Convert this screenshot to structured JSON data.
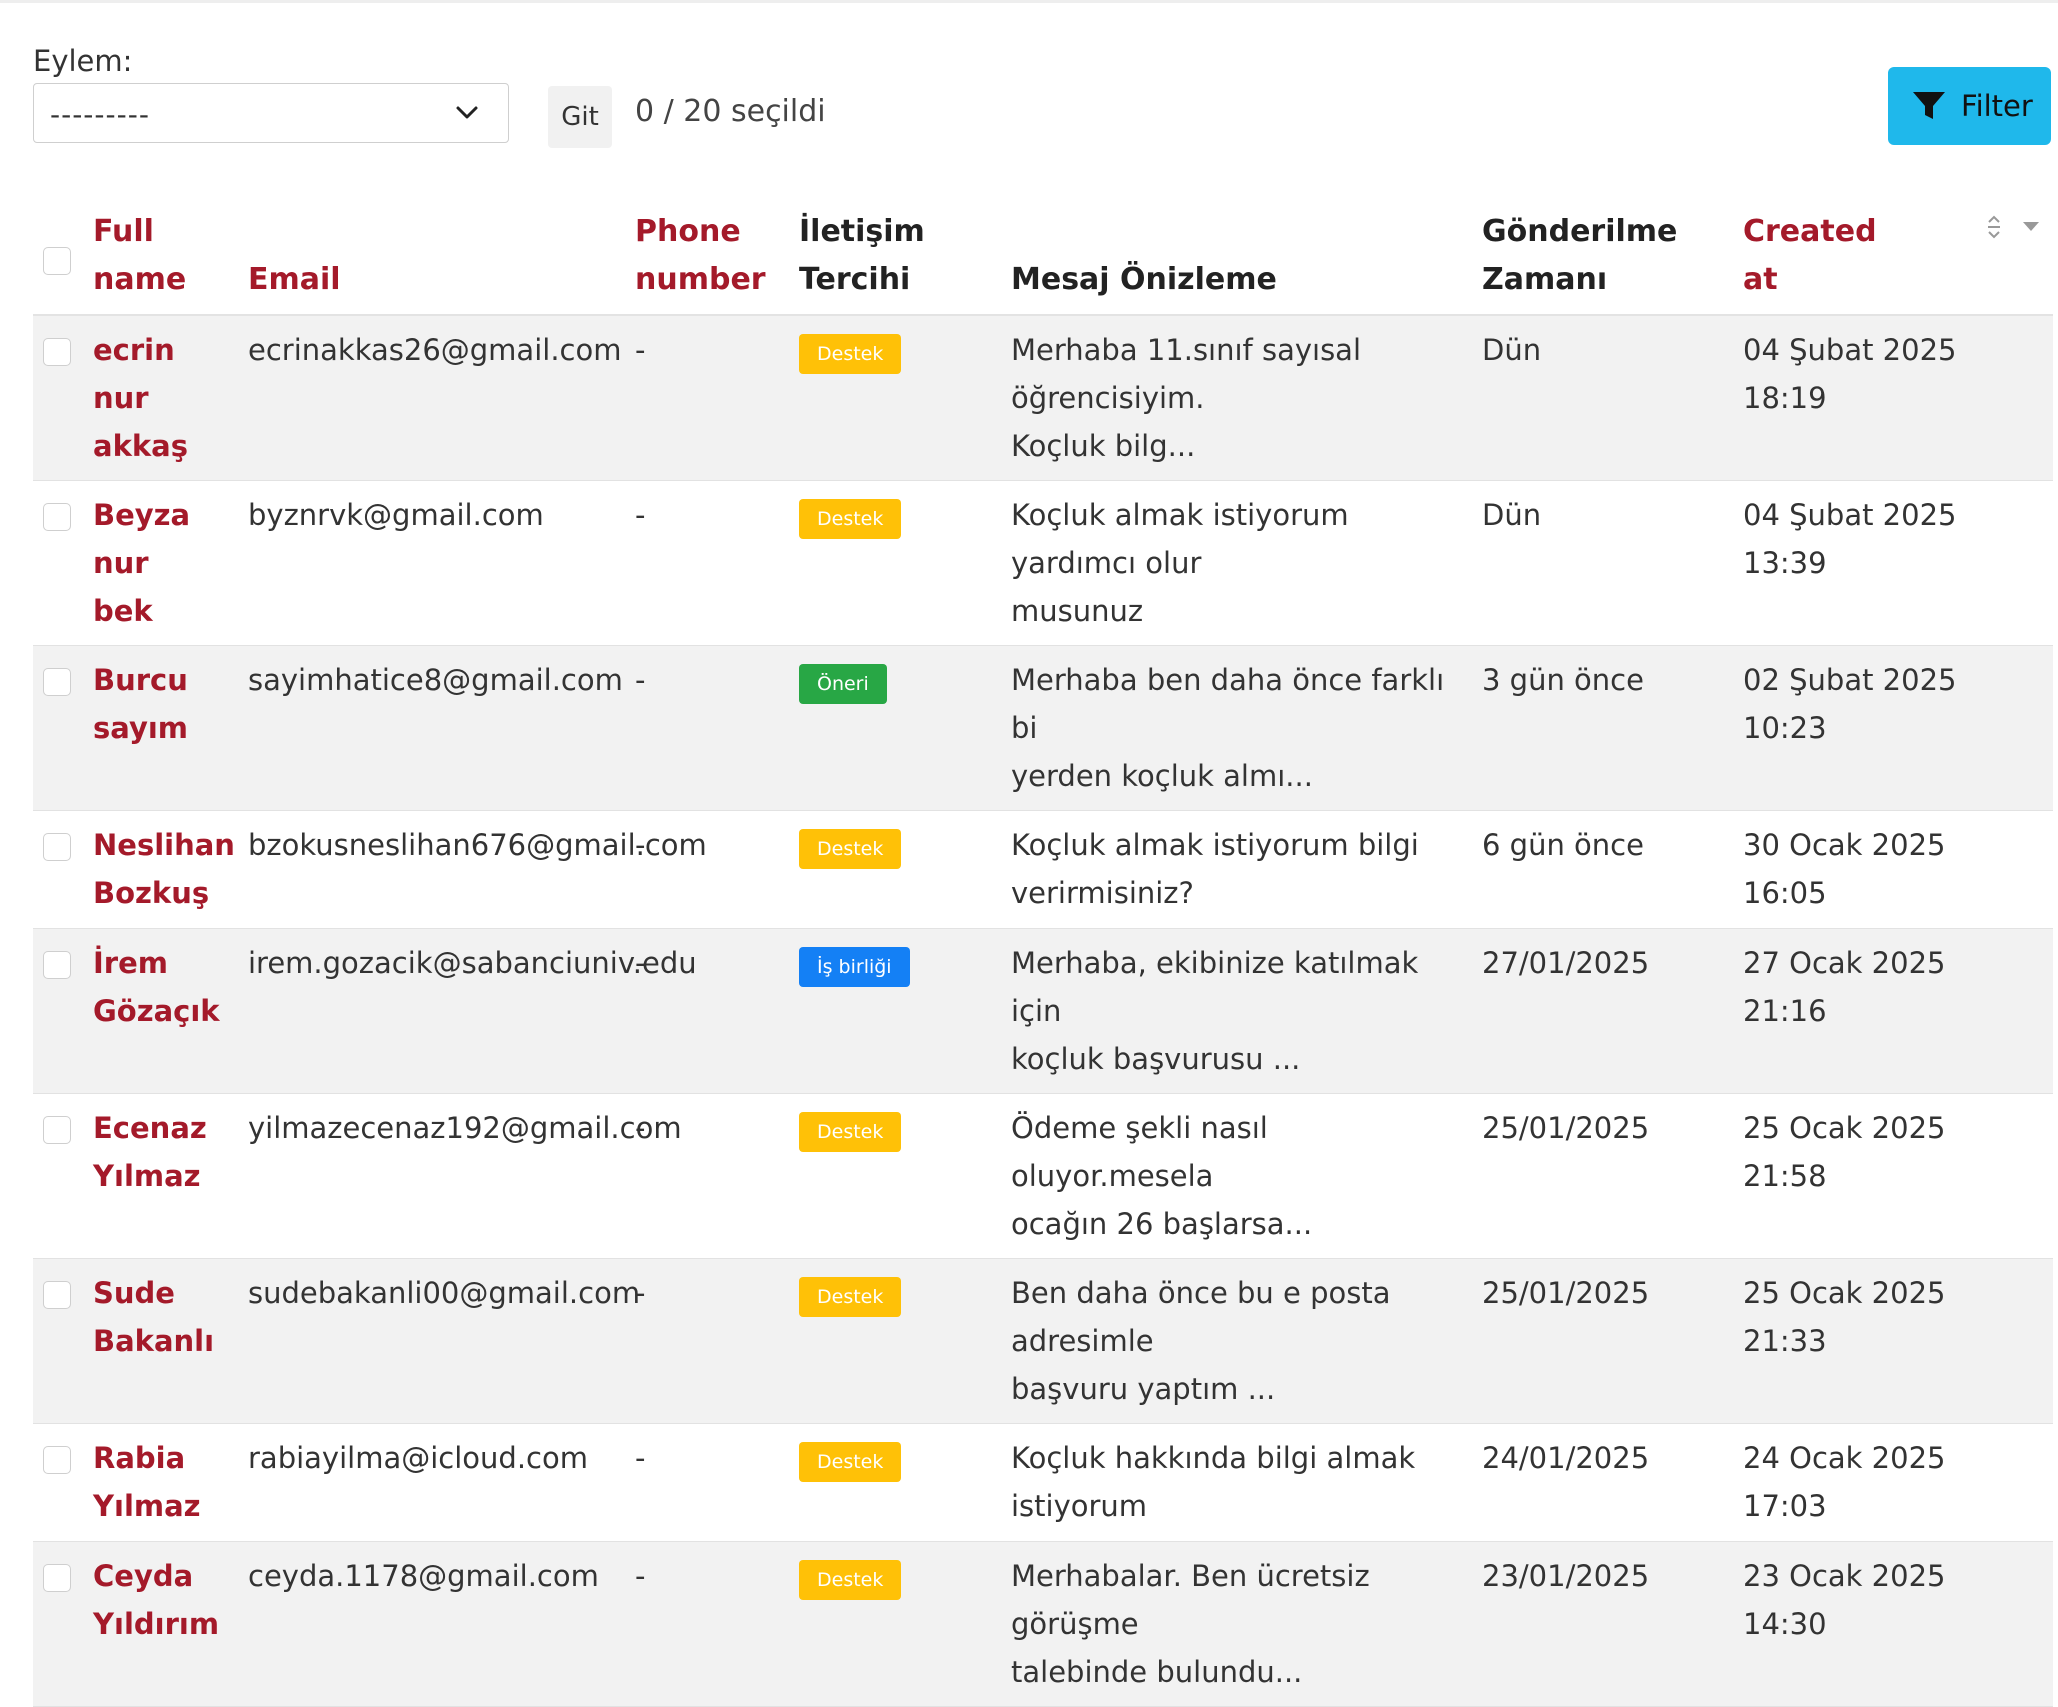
{
  "actions": {
    "label": "Eylem:",
    "selected_value": "---------",
    "go_label": "Git",
    "selection_counter": "0 / 20 seçildi"
  },
  "filter_button": {
    "label": "Filter",
    "color": "#1fb8eb"
  },
  "colors": {
    "link": "#a41a2a",
    "badge_destek": "#ffc107",
    "badge_oneri": "#28a745",
    "badge_isbirligi": "#1480f5"
  },
  "table": {
    "columns": {
      "full_name_l1": "Full",
      "full_name_l2": "name",
      "email": "Email",
      "phone_l1": "Phone",
      "phone_l2": "number",
      "contact_l1": "İletişim",
      "contact_l2": "Tercihi",
      "preview": "Mesaj Önizleme",
      "sent_l1": "Gönderilme",
      "sent_l2": "Zamanı",
      "created_l1": "Created",
      "created_l2": "at"
    },
    "rows": [
      {
        "name_l1": "ecrin nur",
        "name_l2": "akkaş",
        "email": "ecrinakkas26@gmail.com",
        "phone": "-",
        "preference": "Destek",
        "preference_kind": "destek",
        "preview_l1": "Merhaba 11.sınıf sayısal öğrencisiyim.",
        "preview_l2": "Koçluk bilg...",
        "sent": "Dün",
        "created_l1": "04 Şubat 2025",
        "created_l2": "18:19"
      },
      {
        "name_l1": "Beyza nur",
        "name_l2": "bek",
        "email": "byznrvk@gmail.com",
        "phone": "-",
        "preference": "Destek",
        "preference_kind": "destek",
        "preview_l1": "Koçluk almak istiyorum yardımcı olur",
        "preview_l2": "musunuz",
        "sent": "Dün",
        "created_l1": "04 Şubat 2025",
        "created_l2": "13:39"
      },
      {
        "name_l1": "Burcu sayım",
        "name_l2": "",
        "email": "sayimhatice8@gmail.com",
        "phone": "-",
        "preference": "Öneri",
        "preference_kind": "oneri",
        "preview_l1": "Merhaba ben daha önce farklı bi",
        "preview_l2": "yerden koçluk almı...",
        "sent": "3 gün önce",
        "created_l1": "02 Şubat 2025",
        "created_l2": "10:23"
      },
      {
        "name_l1": "Neslihan",
        "name_l2": "Bozkuş",
        "email": "bzokusneslihan676@gmail.com",
        "phone": "-",
        "preference": "Destek",
        "preference_kind": "destek",
        "preview_l1": "Koçluk almak istiyorum bilgi",
        "preview_l2": "verirmisiniz?",
        "sent": "6 gün önce",
        "created_l1": "30 Ocak 2025",
        "created_l2": "16:05"
      },
      {
        "name_l1": "İrem Gözaçık",
        "name_l2": "",
        "email": "irem.gozacik@sabanciuniv.edu",
        "phone": "-",
        "preference": "İş birliği",
        "preference_kind": "isbirligi",
        "preview_l1": "Merhaba, ekibinize katılmak için",
        "preview_l2": "koçluk başvurusu ...",
        "sent": "27/01/2025",
        "created_l1": "27 Ocak 2025",
        "created_l2": "21:16"
      },
      {
        "name_l1": "Ecenaz",
        "name_l2": "Yılmaz",
        "email": "yilmazecenaz192@gmail.com",
        "phone": "-",
        "preference": "Destek",
        "preference_kind": "destek",
        "preview_l1": "Ödeme şekli nasıl oluyor.mesela",
        "preview_l2": "ocağın 26 başlarsa...",
        "sent": "25/01/2025",
        "created_l1": "25 Ocak 2025",
        "created_l2": "21:58"
      },
      {
        "name_l1": "Sude Bakanlı",
        "name_l2": "",
        "email": "sudebakanli00@gmail.com",
        "phone": "-",
        "preference": "Destek",
        "preference_kind": "destek",
        "preview_l1": "Ben daha önce bu e posta adresimle",
        "preview_l2": "başvuru yaptım ...",
        "sent": "25/01/2025",
        "created_l1": "25 Ocak 2025",
        "created_l2": "21:33"
      },
      {
        "name_l1": "Rabia Yılmaz",
        "name_l2": "",
        "email": "rabiayilma@icloud.com",
        "phone": "-",
        "preference": "Destek",
        "preference_kind": "destek",
        "preview_l1": "Koçluk hakkında bilgi almak istiyorum",
        "preview_l2": "",
        "sent": "24/01/2025",
        "created_l1": "24 Ocak 2025",
        "created_l2": "17:03"
      },
      {
        "name_l1": "Ceyda",
        "name_l2": "Yıldırım",
        "email": "ceyda.1178@gmail.com",
        "phone": "-",
        "preference": "Destek",
        "preference_kind": "destek",
        "preview_l1": "Merhabalar. Ben ücretsiz görüşme",
        "preview_l2": "talebinde bulundu...",
        "sent": "23/01/2025",
        "created_l1": "23 Ocak 2025",
        "created_l2": "14:30"
      }
    ]
  }
}
